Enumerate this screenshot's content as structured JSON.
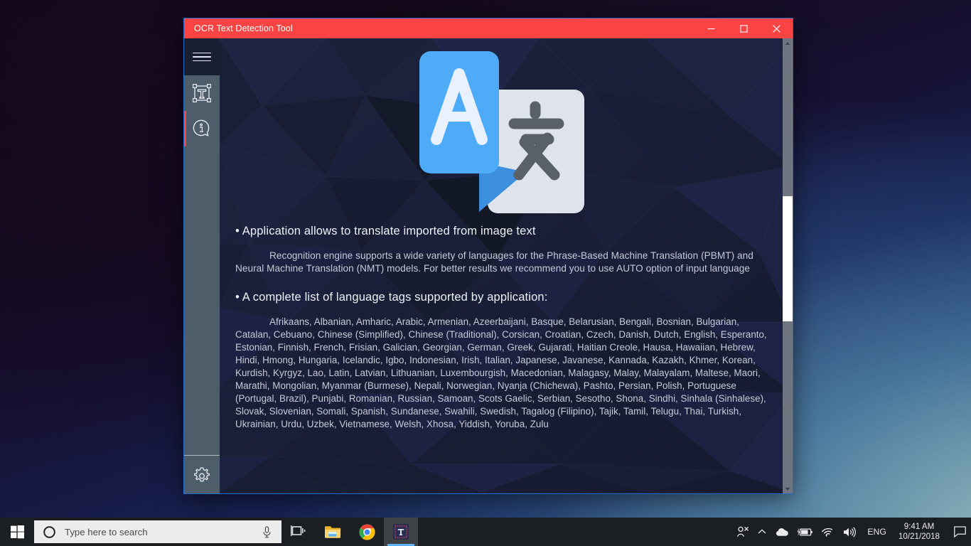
{
  "window": {
    "title": "OCR Text Detection Tool",
    "controls": {
      "minimize": "minimize-button",
      "maximize": "maximize-button",
      "close": "close-button"
    }
  },
  "sidebar": {
    "menu_icon": "hamburger-menu-icon",
    "items": [
      {
        "id": "text-detect",
        "icon": "text-selection-icon",
        "active": false
      },
      {
        "id": "info",
        "icon": "info-bubble-icon",
        "active": true
      }
    ],
    "settings": {
      "icon": "gear-icon"
    }
  },
  "content": {
    "logo": {
      "name": "translate-logo",
      "front_letter": "A",
      "back_glyph": "文",
      "front_color": "#4DABF7",
      "front_color_dark": "#3C8FDD",
      "back_color": "#DFE3EB",
      "glyph_color": "#5A6067"
    },
    "sections": [
      {
        "heading": "• Application allows to translate imported from image text",
        "body": "Recognition engine supports a wide variety of languages for the Phrase-Based Machine Translation (PBMT) and Neural Machine Translation (NMT) models. For better results we recommend you to use AUTO option of input language"
      },
      {
        "heading": "• A complete list of language tags supported by application:",
        "body": "Afrikaans, Albanian, Amharic, Arabic, Armenian, Azeerbaijani, Basque, Belarusian, Bengali, Bosnian, Bulgarian, Catalan, Cebuano, Chinese (Simplified), Chinese (Traditional), Corsican, Croatian, Czech, Danish, Dutch, English, Esperanto, Estonian, Finnish, French, Frisian, Galician, Georgian, German, Greek, Gujarati, Haitian Creole, Hausa, Hawaiian, Hebrew, Hindi, Hmong, Hungaria, Icelandic, Igbo, Indonesian, Irish, Italian, Japanese, Javanese, Kannada, Kazakh, Khmer, Korean, Kurdish, Kyrgyz, Lao, Latin, Latvian, Lithuanian, Luxembourgish, Macedonian, Malagasy, Malay, Malayalam, Maltese, Maori, Marathi, Mongolian, Myanmar (Burmese), Nepali, Norwegian, Nyanja (Chichewa), Pashto, Persian, Polish, Portuguese (Portugal, Brazil), Punjabi, Romanian, Russian, Samoan, Scots Gaelic, Serbian, Sesotho, Shona, Sindhi, Sinhala (Sinhalese), Slovak, Slovenian, Somali, Spanish, Sundanese, Swahili, Swedish, Tagalog (Filipino), Tajik, Tamil, Telugu, Thai, Turkish, Ukrainian, Urdu, Uzbek, Vietnamese, Welsh, Xhosa, Yiddish, Yoruba, Zulu"
      }
    ]
  },
  "scrollbar": {
    "name": "vertical-scrollbar",
    "thumb": "scrollbar-thumb"
  },
  "taskbar": {
    "start": "windows-start-icon",
    "search": {
      "placeholder": "Type here to search",
      "cortana_icon": "cortana-circle-icon",
      "mic_icon": "microphone-icon"
    },
    "buttons": [
      {
        "name": "task-view-button",
        "icon": "task-view-icon"
      },
      {
        "name": "file-explorer-button",
        "icon": "folder-icon"
      },
      {
        "name": "chrome-button",
        "icon": "chrome-icon"
      },
      {
        "name": "ocr-tool-button",
        "icon": "ocr-app-icon"
      }
    ],
    "tray": {
      "people": "people-icon",
      "chevron": "show-hidden-icons-chevron",
      "onedrive": "onedrive-cloud-icon",
      "battery": "battery-charging-icon",
      "wifi": "wifi-icon",
      "volume": "volume-icon",
      "language": "ENG",
      "time": "9:41 AM",
      "date": "10/21/2018",
      "action_center": "action-center-icon"
    }
  },
  "colors": {
    "titlebar": "#FA4443",
    "sidebar": "#4E5D6A",
    "sidebar_top": "#191F33",
    "content_bg": "#1B2038",
    "accent_red": "#FA4443",
    "window_border": "#1F6FD0",
    "taskbar": "#1B1E22"
  }
}
